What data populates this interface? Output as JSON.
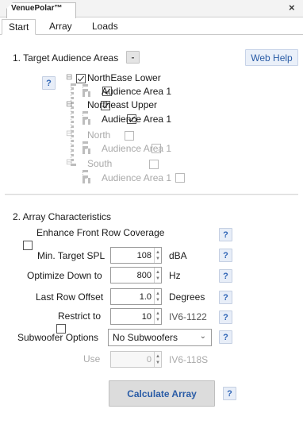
{
  "window": {
    "doc_tab_title": "VenuePolar™",
    "close_glyph": "×"
  },
  "tabs": [
    "Start",
    "Array",
    "Loads"
  ],
  "section1": {
    "title": "1. Target Audience Areas",
    "dropdown_glyph": "-",
    "web_help": "Web Help",
    "help_glyph": "?",
    "tree": [
      {
        "label": "NorthEase Lower",
        "checked": true,
        "enabled": true,
        "child": "Audience Area 1",
        "child_checked": true
      },
      {
        "label": "Northeast Upper",
        "checked": true,
        "enabled": true,
        "child": "Audience Area 1",
        "child_checked": true
      },
      {
        "label": "North",
        "checked": false,
        "enabled": false,
        "child": "Audience Area 1",
        "child_checked": false
      },
      {
        "label": "South",
        "checked": false,
        "enabled": false,
        "child": "Audience Area 1",
        "child_checked": false
      }
    ],
    "expander_glyph": "⊟"
  },
  "section2": {
    "title": "2. Array Characteristics",
    "enhance_label": "Enhance Front Row Coverage",
    "enhance_checked": false,
    "min_spl_label": "Min. Target SPL",
    "min_spl_value": "108",
    "min_spl_unit": "dBA",
    "optimize_label": "Optimize Down to",
    "optimize_value": "800",
    "optimize_unit": "Hz",
    "last_row_label": "Last Row Offset",
    "last_row_value": "1.0",
    "last_row_unit": "Degrees",
    "restrict_label": "Restrict to",
    "restrict_checked": false,
    "restrict_value": "10",
    "restrict_unit": "IV6-1122",
    "sub_label": "Subwoofer Options",
    "sub_value": "No Subwoofers",
    "use_label": "Use",
    "use_value": "0",
    "use_unit": "IV6-118S",
    "calc_label": "Calculate Array",
    "help_glyph": "?",
    "spin_up": "▲",
    "spin_down": "▼",
    "chevron": "⌄"
  }
}
